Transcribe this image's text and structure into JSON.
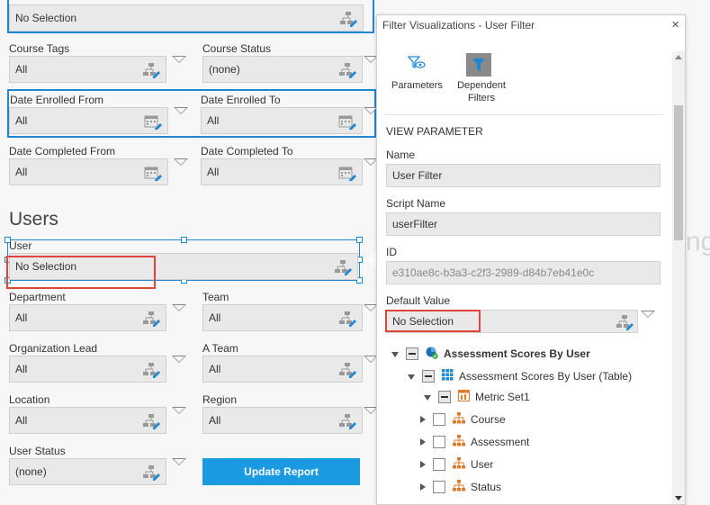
{
  "form": {
    "top_field_value": "No Selection",
    "course_tags": {
      "label": "Course Tags",
      "value": "All"
    },
    "course_status": {
      "label": "Course Status",
      "value": "(none)"
    },
    "date_enrolled_from": {
      "label": "Date Enrolled From",
      "value": "All"
    },
    "date_enrolled_to": {
      "label": "Date Enrolled To",
      "value": "All"
    },
    "date_completed_from": {
      "label": "Date Completed From",
      "value": "All"
    },
    "date_completed_to": {
      "label": "Date Completed To",
      "value": "All"
    },
    "users_heading": "Users",
    "user": {
      "label": "User",
      "value": "No Selection"
    },
    "department": {
      "label": "Department",
      "value": "All"
    },
    "team": {
      "label": "Team",
      "value": "All"
    },
    "organization_lead": {
      "label": "Organization Lead",
      "value": "All"
    },
    "a_team": {
      "label": "A Team",
      "value": "All"
    },
    "location": {
      "label": "Location",
      "value": "All"
    },
    "region": {
      "label": "Region",
      "value": "All"
    },
    "user_status": {
      "label": "User Status",
      "value": "(none)"
    },
    "update_button": "Update Report"
  },
  "panel": {
    "title": "Filter Visualizations - User Filter",
    "close": "×",
    "toolbar": {
      "parameters": "Parameters",
      "dependent_filters_line1": "Dependent",
      "dependent_filters_line2": "Filters"
    },
    "section_heading": "VIEW PARAMETER",
    "name_label": "Name",
    "name_value": "User Filter",
    "script_label": "Script Name",
    "script_value": "userFilter",
    "id_label": "ID",
    "id_value": "e310ae8c-b3a3-c2f3-2989-d84b7eb41e0c",
    "default_label": "Default Value",
    "default_value": "No Selection",
    "tree": [
      "Assessment Scores By User",
      "Assessment Scores By User (Table)",
      "Metric Set1",
      "Course",
      "Assessment",
      "User",
      "Status"
    ]
  },
  "background_text": "ng",
  "colors": {
    "accent": "#1e88d2",
    "highlight_box": "#e0443c",
    "button": "#1a9ae0"
  }
}
